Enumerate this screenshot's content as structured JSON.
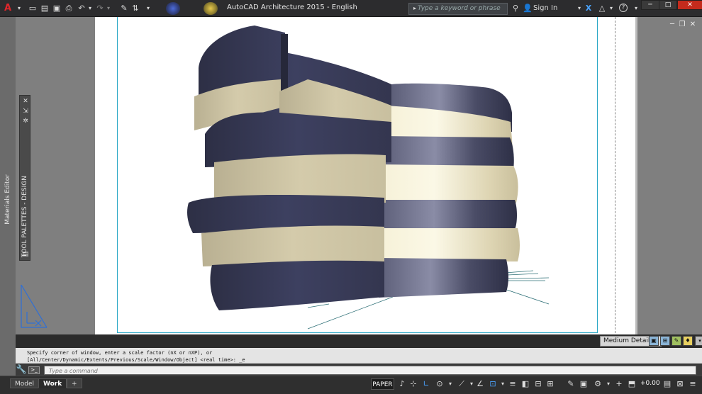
{
  "titlebar": {
    "title": "AutoCAD Architecture 2015 - English",
    "search_placeholder": "Type a keyword or phrase",
    "sign_in": "Sign In",
    "app_icon": "autocad-a-icon"
  },
  "palettes": {
    "materials_editor": "Materials Editor",
    "tool_palettes": "TOOL PALETTES - DESIGN"
  },
  "layoutbar": {
    "detail_level": "Medium Detail"
  },
  "command": {
    "history_line1": "Specify corner of window, enter a scale factor (nX or nXP), or",
    "history_line2": "[All/Center/Dynamic/Extents/Previous/Scale/Window/Object] <real time>: _e",
    "input_placeholder": "Type a command"
  },
  "status": {
    "tab_model": "Model",
    "tab_work": "Work",
    "tab_add": "+",
    "space": "PAPER",
    "elevation": "+0.00"
  },
  "colors": {
    "dark_band": "#3b3d55",
    "light_band": "#cfc6a6",
    "viewport_border": "#2aa8c6",
    "accent_blue": "#4aa3ff"
  }
}
